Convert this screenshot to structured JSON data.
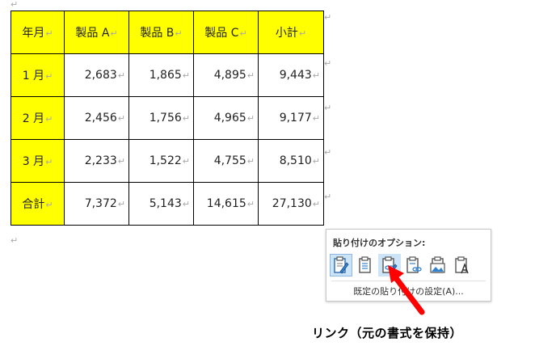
{
  "paragraph_mark": "↵",
  "table": {
    "headers": [
      "年月",
      "製品 A",
      "製品 B",
      "製品 C",
      "小計"
    ],
    "rows": [
      {
        "label": "1 月",
        "a": "2,683",
        "b": "1,865",
        "c": "4,895",
        "subtotal": "9,443"
      },
      {
        "label": "2 月",
        "a": "2,456",
        "b": "1,756",
        "c": "4,965",
        "subtotal": "9,177"
      },
      {
        "label": "3 月",
        "a": "2,233",
        "b": "1,522",
        "c": "4,755",
        "subtotal": "8,510"
      },
      {
        "label": "合計",
        "a": "7,372",
        "b": "5,143",
        "c": "14,615",
        "subtotal": "27,130"
      }
    ],
    "header_color": "#ffff00"
  },
  "paste_options": {
    "title": "貼り付けのオプション:",
    "icons": [
      "paste-keep-source-formatting-icon",
      "paste-destination-style-icon",
      "paste-link-keep-source-icon",
      "paste-link-destination-style-icon",
      "paste-picture-icon",
      "paste-text-only-icon"
    ],
    "default_settings_link": "既定の貼り付けの設定(A)..."
  },
  "annotation": {
    "caption": "リンク（元の書式を保持）",
    "arrow_color": "#ff0000"
  }
}
